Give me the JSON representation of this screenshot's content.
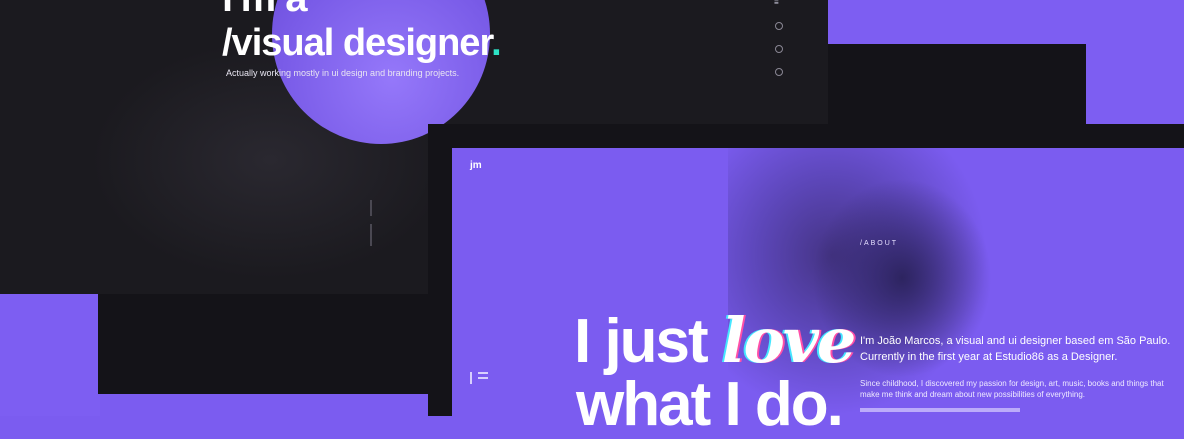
{
  "dark_mockup": {
    "hero_prefix": "i'm a",
    "hero_title": "/visual designer",
    "hero_dot": ".",
    "hero_subtitle": "Actually working mostly in ui design and branding projects.",
    "nav_mark": "≡"
  },
  "purple_mockup": {
    "logo": "jm",
    "section_label": "/ABOUT",
    "headline_part1": "I just ",
    "headline_emphasis": "love",
    "headline_part2": "what I do.",
    "bio_line1": "I'm João Marcos, a visual and ui designer based em São Paulo.",
    "bio_line2": "Currently in the first year at Estudio86 as a Designer.",
    "bio_line3": "Since childhood, I discovered my passion for design, art, music, books and things that",
    "bio_line4": "make me think and dream about new possibilities of everything."
  },
  "colors": {
    "accent_purple": "#7b5cf0",
    "dark_bg": "#1b1a1f",
    "teal_dot": "#2de3c6"
  }
}
